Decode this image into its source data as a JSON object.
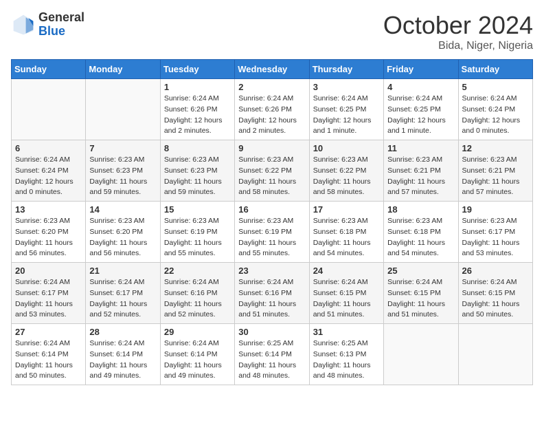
{
  "header": {
    "logo_general": "General",
    "logo_blue": "Blue",
    "month": "October 2024",
    "location": "Bida, Niger, Nigeria"
  },
  "weekdays": [
    "Sunday",
    "Monday",
    "Tuesday",
    "Wednesday",
    "Thursday",
    "Friday",
    "Saturday"
  ],
  "weeks": [
    [
      {
        "day": "",
        "sunrise": "",
        "sunset": "",
        "daylight": ""
      },
      {
        "day": "",
        "sunrise": "",
        "sunset": "",
        "daylight": ""
      },
      {
        "day": "1",
        "sunrise": "Sunrise: 6:24 AM",
        "sunset": "Sunset: 6:26 PM",
        "daylight": "Daylight: 12 hours and 2 minutes."
      },
      {
        "day": "2",
        "sunrise": "Sunrise: 6:24 AM",
        "sunset": "Sunset: 6:26 PM",
        "daylight": "Daylight: 12 hours and 2 minutes."
      },
      {
        "day": "3",
        "sunrise": "Sunrise: 6:24 AM",
        "sunset": "Sunset: 6:25 PM",
        "daylight": "Daylight: 12 hours and 1 minute."
      },
      {
        "day": "4",
        "sunrise": "Sunrise: 6:24 AM",
        "sunset": "Sunset: 6:25 PM",
        "daylight": "Daylight: 12 hours and 1 minute."
      },
      {
        "day": "5",
        "sunrise": "Sunrise: 6:24 AM",
        "sunset": "Sunset: 6:24 PM",
        "daylight": "Daylight: 12 hours and 0 minutes."
      }
    ],
    [
      {
        "day": "6",
        "sunrise": "Sunrise: 6:24 AM",
        "sunset": "Sunset: 6:24 PM",
        "daylight": "Daylight: 12 hours and 0 minutes."
      },
      {
        "day": "7",
        "sunrise": "Sunrise: 6:23 AM",
        "sunset": "Sunset: 6:23 PM",
        "daylight": "Daylight: 11 hours and 59 minutes."
      },
      {
        "day": "8",
        "sunrise": "Sunrise: 6:23 AM",
        "sunset": "Sunset: 6:23 PM",
        "daylight": "Daylight: 11 hours and 59 minutes."
      },
      {
        "day": "9",
        "sunrise": "Sunrise: 6:23 AM",
        "sunset": "Sunset: 6:22 PM",
        "daylight": "Daylight: 11 hours and 58 minutes."
      },
      {
        "day": "10",
        "sunrise": "Sunrise: 6:23 AM",
        "sunset": "Sunset: 6:22 PM",
        "daylight": "Daylight: 11 hours and 58 minutes."
      },
      {
        "day": "11",
        "sunrise": "Sunrise: 6:23 AM",
        "sunset": "Sunset: 6:21 PM",
        "daylight": "Daylight: 11 hours and 57 minutes."
      },
      {
        "day": "12",
        "sunrise": "Sunrise: 6:23 AM",
        "sunset": "Sunset: 6:21 PM",
        "daylight": "Daylight: 11 hours and 57 minutes."
      }
    ],
    [
      {
        "day": "13",
        "sunrise": "Sunrise: 6:23 AM",
        "sunset": "Sunset: 6:20 PM",
        "daylight": "Daylight: 11 hours and 56 minutes."
      },
      {
        "day": "14",
        "sunrise": "Sunrise: 6:23 AM",
        "sunset": "Sunset: 6:20 PM",
        "daylight": "Daylight: 11 hours and 56 minutes."
      },
      {
        "day": "15",
        "sunrise": "Sunrise: 6:23 AM",
        "sunset": "Sunset: 6:19 PM",
        "daylight": "Daylight: 11 hours and 55 minutes."
      },
      {
        "day": "16",
        "sunrise": "Sunrise: 6:23 AM",
        "sunset": "Sunset: 6:19 PM",
        "daylight": "Daylight: 11 hours and 55 minutes."
      },
      {
        "day": "17",
        "sunrise": "Sunrise: 6:23 AM",
        "sunset": "Sunset: 6:18 PM",
        "daylight": "Daylight: 11 hours and 54 minutes."
      },
      {
        "day": "18",
        "sunrise": "Sunrise: 6:23 AM",
        "sunset": "Sunset: 6:18 PM",
        "daylight": "Daylight: 11 hours and 54 minutes."
      },
      {
        "day": "19",
        "sunrise": "Sunrise: 6:23 AM",
        "sunset": "Sunset: 6:17 PM",
        "daylight": "Daylight: 11 hours and 53 minutes."
      }
    ],
    [
      {
        "day": "20",
        "sunrise": "Sunrise: 6:24 AM",
        "sunset": "Sunset: 6:17 PM",
        "daylight": "Daylight: 11 hours and 53 minutes."
      },
      {
        "day": "21",
        "sunrise": "Sunrise: 6:24 AM",
        "sunset": "Sunset: 6:17 PM",
        "daylight": "Daylight: 11 hours and 52 minutes."
      },
      {
        "day": "22",
        "sunrise": "Sunrise: 6:24 AM",
        "sunset": "Sunset: 6:16 PM",
        "daylight": "Daylight: 11 hours and 52 minutes."
      },
      {
        "day": "23",
        "sunrise": "Sunrise: 6:24 AM",
        "sunset": "Sunset: 6:16 PM",
        "daylight": "Daylight: 11 hours and 51 minutes."
      },
      {
        "day": "24",
        "sunrise": "Sunrise: 6:24 AM",
        "sunset": "Sunset: 6:15 PM",
        "daylight": "Daylight: 11 hours and 51 minutes."
      },
      {
        "day": "25",
        "sunrise": "Sunrise: 6:24 AM",
        "sunset": "Sunset: 6:15 PM",
        "daylight": "Daylight: 11 hours and 51 minutes."
      },
      {
        "day": "26",
        "sunrise": "Sunrise: 6:24 AM",
        "sunset": "Sunset: 6:15 PM",
        "daylight": "Daylight: 11 hours and 50 minutes."
      }
    ],
    [
      {
        "day": "27",
        "sunrise": "Sunrise: 6:24 AM",
        "sunset": "Sunset: 6:14 PM",
        "daylight": "Daylight: 11 hours and 50 minutes."
      },
      {
        "day": "28",
        "sunrise": "Sunrise: 6:24 AM",
        "sunset": "Sunset: 6:14 PM",
        "daylight": "Daylight: 11 hours and 49 minutes."
      },
      {
        "day": "29",
        "sunrise": "Sunrise: 6:24 AM",
        "sunset": "Sunset: 6:14 PM",
        "daylight": "Daylight: 11 hours and 49 minutes."
      },
      {
        "day": "30",
        "sunrise": "Sunrise: 6:25 AM",
        "sunset": "Sunset: 6:14 PM",
        "daylight": "Daylight: 11 hours and 48 minutes."
      },
      {
        "day": "31",
        "sunrise": "Sunrise: 6:25 AM",
        "sunset": "Sunset: 6:13 PM",
        "daylight": "Daylight: 11 hours and 48 minutes."
      },
      {
        "day": "",
        "sunrise": "",
        "sunset": "",
        "daylight": ""
      },
      {
        "day": "",
        "sunrise": "",
        "sunset": "",
        "daylight": ""
      }
    ]
  ]
}
